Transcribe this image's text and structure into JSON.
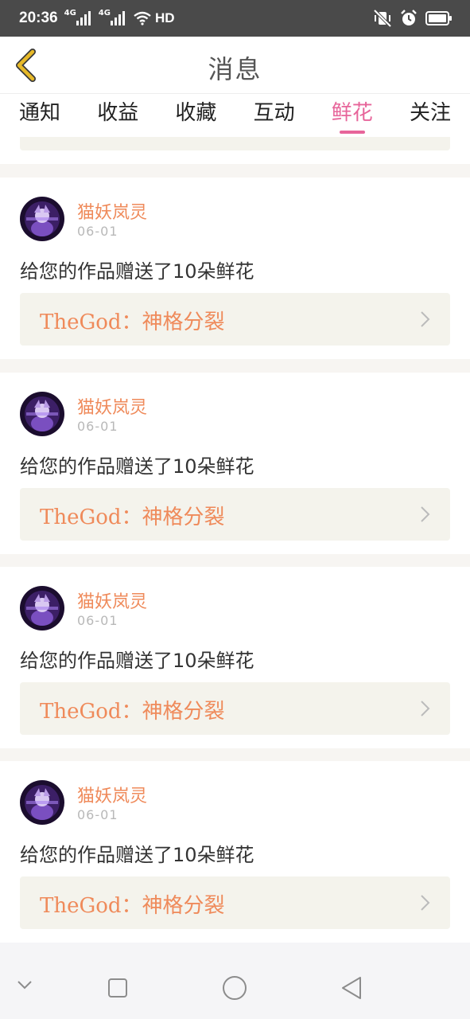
{
  "status_bar": {
    "time": "20:36",
    "network_1": "4G",
    "network_2": "4G",
    "hd_label": "HD",
    "icons": [
      "signal-icon",
      "signal-icon",
      "wifi-icon",
      "mute-vibrate-icon",
      "alarm-icon",
      "battery-icon"
    ]
  },
  "nav": {
    "back_icon": "chevron-left-icon",
    "title": "消息"
  },
  "tabs": [
    {
      "label": "通知",
      "active": false
    },
    {
      "label": "收益",
      "active": false
    },
    {
      "label": "收藏",
      "active": false
    },
    {
      "label": "互动",
      "active": false
    },
    {
      "label": "鲜花",
      "active": true
    },
    {
      "label": "关注",
      "active": false
    }
  ],
  "messages": [
    {
      "sender": "猫妖岚灵",
      "date": "06-01",
      "text": "给您的作品赠送了10朵鲜花",
      "work_title": "TheGod：神格分裂"
    },
    {
      "sender": "猫妖岚灵",
      "date": "06-01",
      "text": "给您的作品赠送了10朵鲜花",
      "work_title": "TheGod：神格分裂"
    },
    {
      "sender": "猫妖岚灵",
      "date": "06-01",
      "text": "给您的作品赠送了10朵鲜花",
      "work_title": "TheGod：神格分裂"
    },
    {
      "sender": "猫妖岚灵",
      "date": "06-01",
      "text": "给您的作品赠送了10朵鲜花",
      "work_title": "TheGod：神格分裂"
    }
  ],
  "system_nav": {
    "icons": [
      "chevron-down-icon",
      "recent-apps-icon",
      "home-icon",
      "back-triangle-icon"
    ]
  },
  "colors": {
    "accent_pink": "#e7659a",
    "accent_orange": "#ef8a5a",
    "link_background": "#f4f3ec",
    "back_icon_yellow": "#e7b928"
  }
}
